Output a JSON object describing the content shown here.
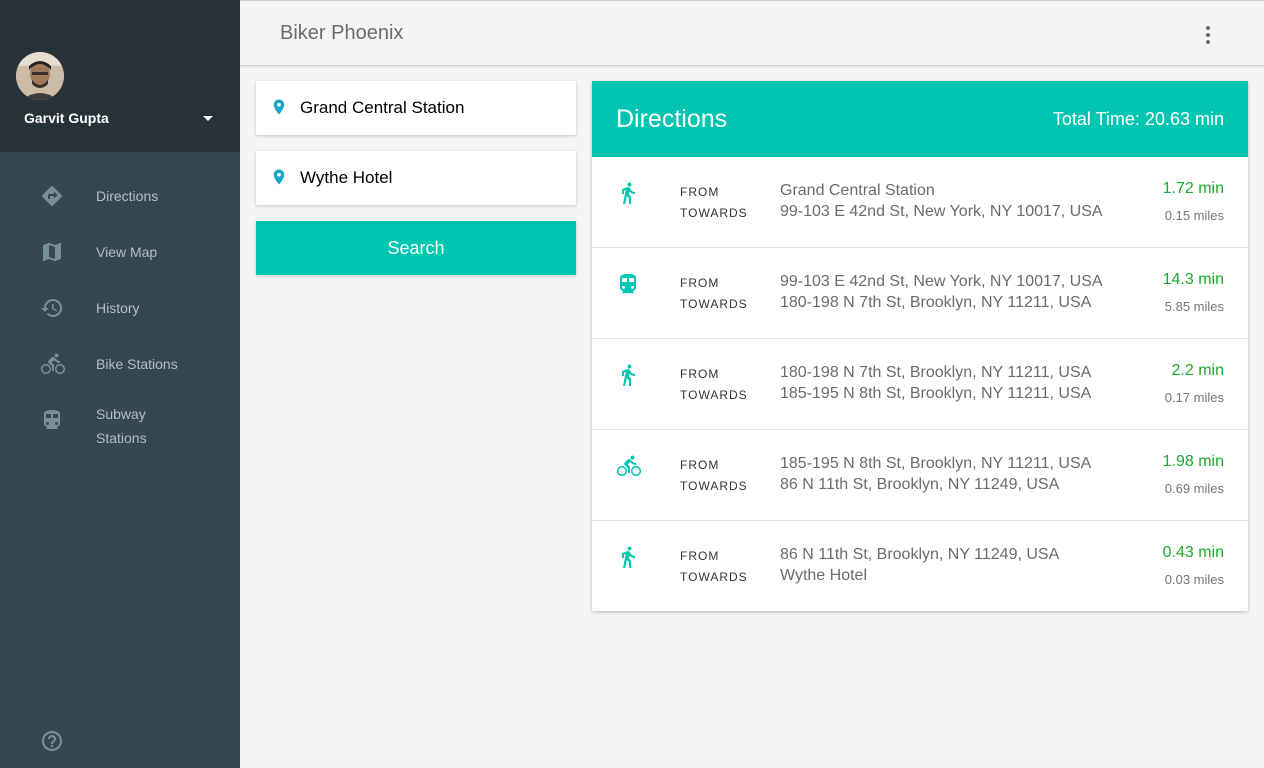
{
  "colors": {
    "accent": "#00c6b1",
    "sidebar_bg": "#37474f",
    "profile_bg": "#263238",
    "time_green": "#1aab2a",
    "pin_blue": "#1ba5c9"
  },
  "user": {
    "name": "Garvit Gupta"
  },
  "sidebar": {
    "items": [
      {
        "label": "Directions",
        "icon": "directions-icon"
      },
      {
        "label": "View Map",
        "icon": "map-icon"
      },
      {
        "label": "History",
        "icon": "history-icon"
      },
      {
        "label": "Bike Stations",
        "icon": "bike-icon"
      },
      {
        "label": "Subway Stations",
        "icon": "subway-icon"
      }
    ],
    "help_icon": "help-icon"
  },
  "header": {
    "title": "Biker Phoenix",
    "menu_icon": "more-vert-icon"
  },
  "search": {
    "origin_value": "Grand Central Station",
    "destination_value": "Wythe Hotel",
    "button_label": "Search"
  },
  "directions": {
    "title": "Directions",
    "total_time": "Total Time: 20.63 min",
    "from_label": "FROM",
    "towards_label": "TOWARDS",
    "steps": [
      {
        "mode": "walk-icon",
        "from": "Grand Central Station",
        "to": "99-103 E 42nd St, New York, NY 10017, USA",
        "time": "1.72 min",
        "distance": "0.15 miles"
      },
      {
        "mode": "subway-icon",
        "from": "99-103 E 42nd St, New York, NY 10017, USA",
        "to": "180-198 N 7th St, Brooklyn, NY 11211, USA",
        "time": "14.3 min",
        "distance": "5.85 miles"
      },
      {
        "mode": "walk-icon",
        "from": "180-198 N 7th St, Brooklyn, NY 11211, USA",
        "to": "185-195 N 8th St, Brooklyn, NY 11211, USA",
        "time": "2.2 min",
        "distance": "0.17 miles"
      },
      {
        "mode": "bike-icon",
        "from": "185-195 N 8th St, Brooklyn, NY 11211, USA",
        "to": "86 N 11th St, Brooklyn, NY 11249, USA",
        "time": "1.98 min",
        "distance": "0.69 miles"
      },
      {
        "mode": "walk-icon",
        "from": "86 N 11th St, Brooklyn, NY 11249, USA",
        "to": "Wythe Hotel",
        "time": "0.43 min",
        "distance": "0.03 miles"
      }
    ]
  }
}
